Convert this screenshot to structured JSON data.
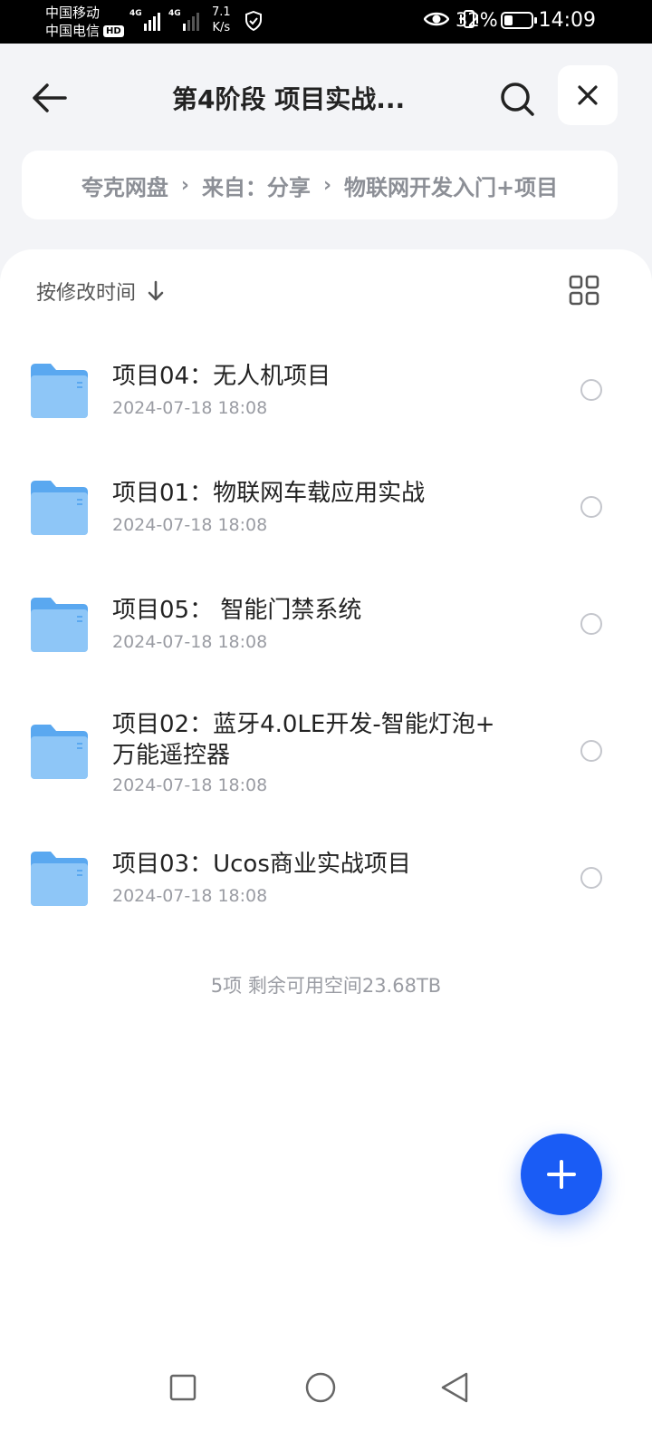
{
  "status_bar": {
    "carrier_1": "中国移动",
    "carrier_2": "中国电信",
    "hd_badge": "HD",
    "network_1": "4G",
    "network_2": "4G",
    "speed_value": "7.1",
    "speed_unit": "K/s",
    "battery_percent": "32%",
    "battery_level": 0.32,
    "time": "14:09"
  },
  "header": {
    "title": "第4阶段 项目实战..."
  },
  "breadcrumb": {
    "items": [
      "夸克网盘",
      "来自：分享",
      "物联网开发入门+项目"
    ]
  },
  "sort": {
    "label": "按修改时间"
  },
  "files": [
    {
      "name": "项目04：无人机项目",
      "date": "2024-07-18 18:08"
    },
    {
      "name": "项目01：物联网车载应用实战",
      "date": "2024-07-18 18:08"
    },
    {
      "name": "项目05： 智能门禁系统",
      "date": "2024-07-18 18:08"
    },
    {
      "name_line1": "项目02：蓝牙4.0LE开发-智能灯泡+",
      "name_line2": "万能遥控器",
      "date": "2024-07-18 18:08"
    },
    {
      "name": "项目03：Ucos商业实战项目",
      "date": "2024-07-18 18:08"
    }
  ],
  "summary": "5项 剩余可用空间23.68TB",
  "colors": {
    "accent": "#1a5cf5",
    "folder": "#5aa8f0",
    "background": "#f3f4f7"
  }
}
